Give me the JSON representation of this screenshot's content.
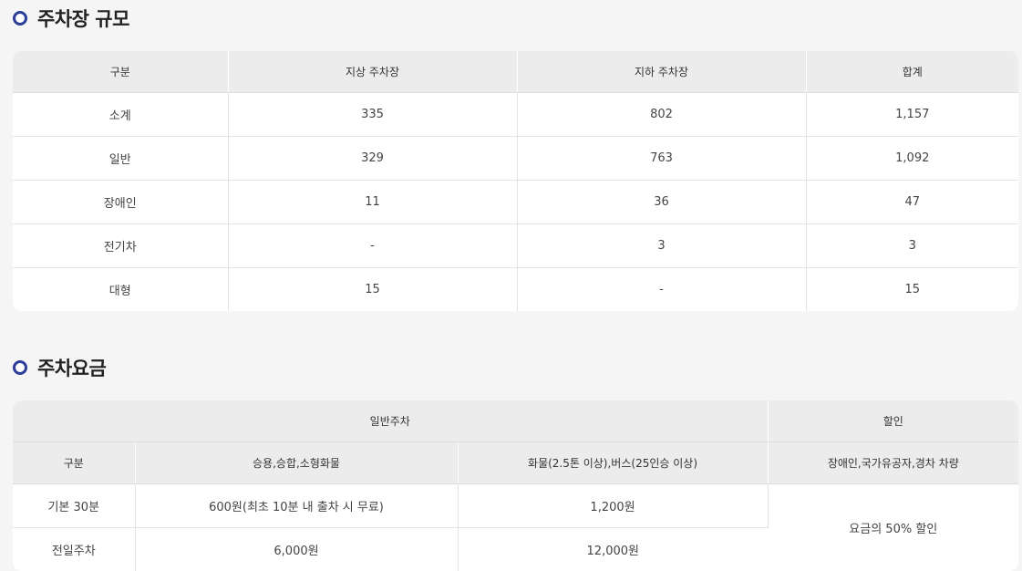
{
  "parking_scale": {
    "title": "주차장 규모",
    "headers": [
      "구분",
      "지상 주차장",
      "지하 주차장",
      "합계"
    ],
    "rows": [
      [
        "소계",
        "335",
        "802",
        "1,157"
      ],
      [
        "일반",
        "329",
        "763",
        "1,092"
      ],
      [
        "장애인",
        "11",
        "36",
        "47"
      ],
      [
        "전기차",
        "-",
        "3",
        "3"
      ],
      [
        "대형",
        "15",
        "-",
        "15"
      ]
    ]
  },
  "parking_fee": {
    "title": "주차요금",
    "group_general": "일반주차",
    "group_discount": "할인",
    "headers": [
      "구분",
      "승용,승합,소형화물",
      "화물(2.5톤 이상),버스(25인승 이상)",
      "장애인,국가유공자,경차 차량"
    ],
    "rows": [
      [
        "기본 30분",
        "600원(최초 10분 내 출차 시 무료)",
        "1,200원"
      ],
      [
        "전일주차",
        "6,000원",
        "12,000원"
      ]
    ],
    "discount_text": "요금의 50% 할인"
  },
  "colors": {
    "accent": "#2b3e9a",
    "header_bg": "#ececec",
    "page_bg": "#f5f5f5"
  }
}
